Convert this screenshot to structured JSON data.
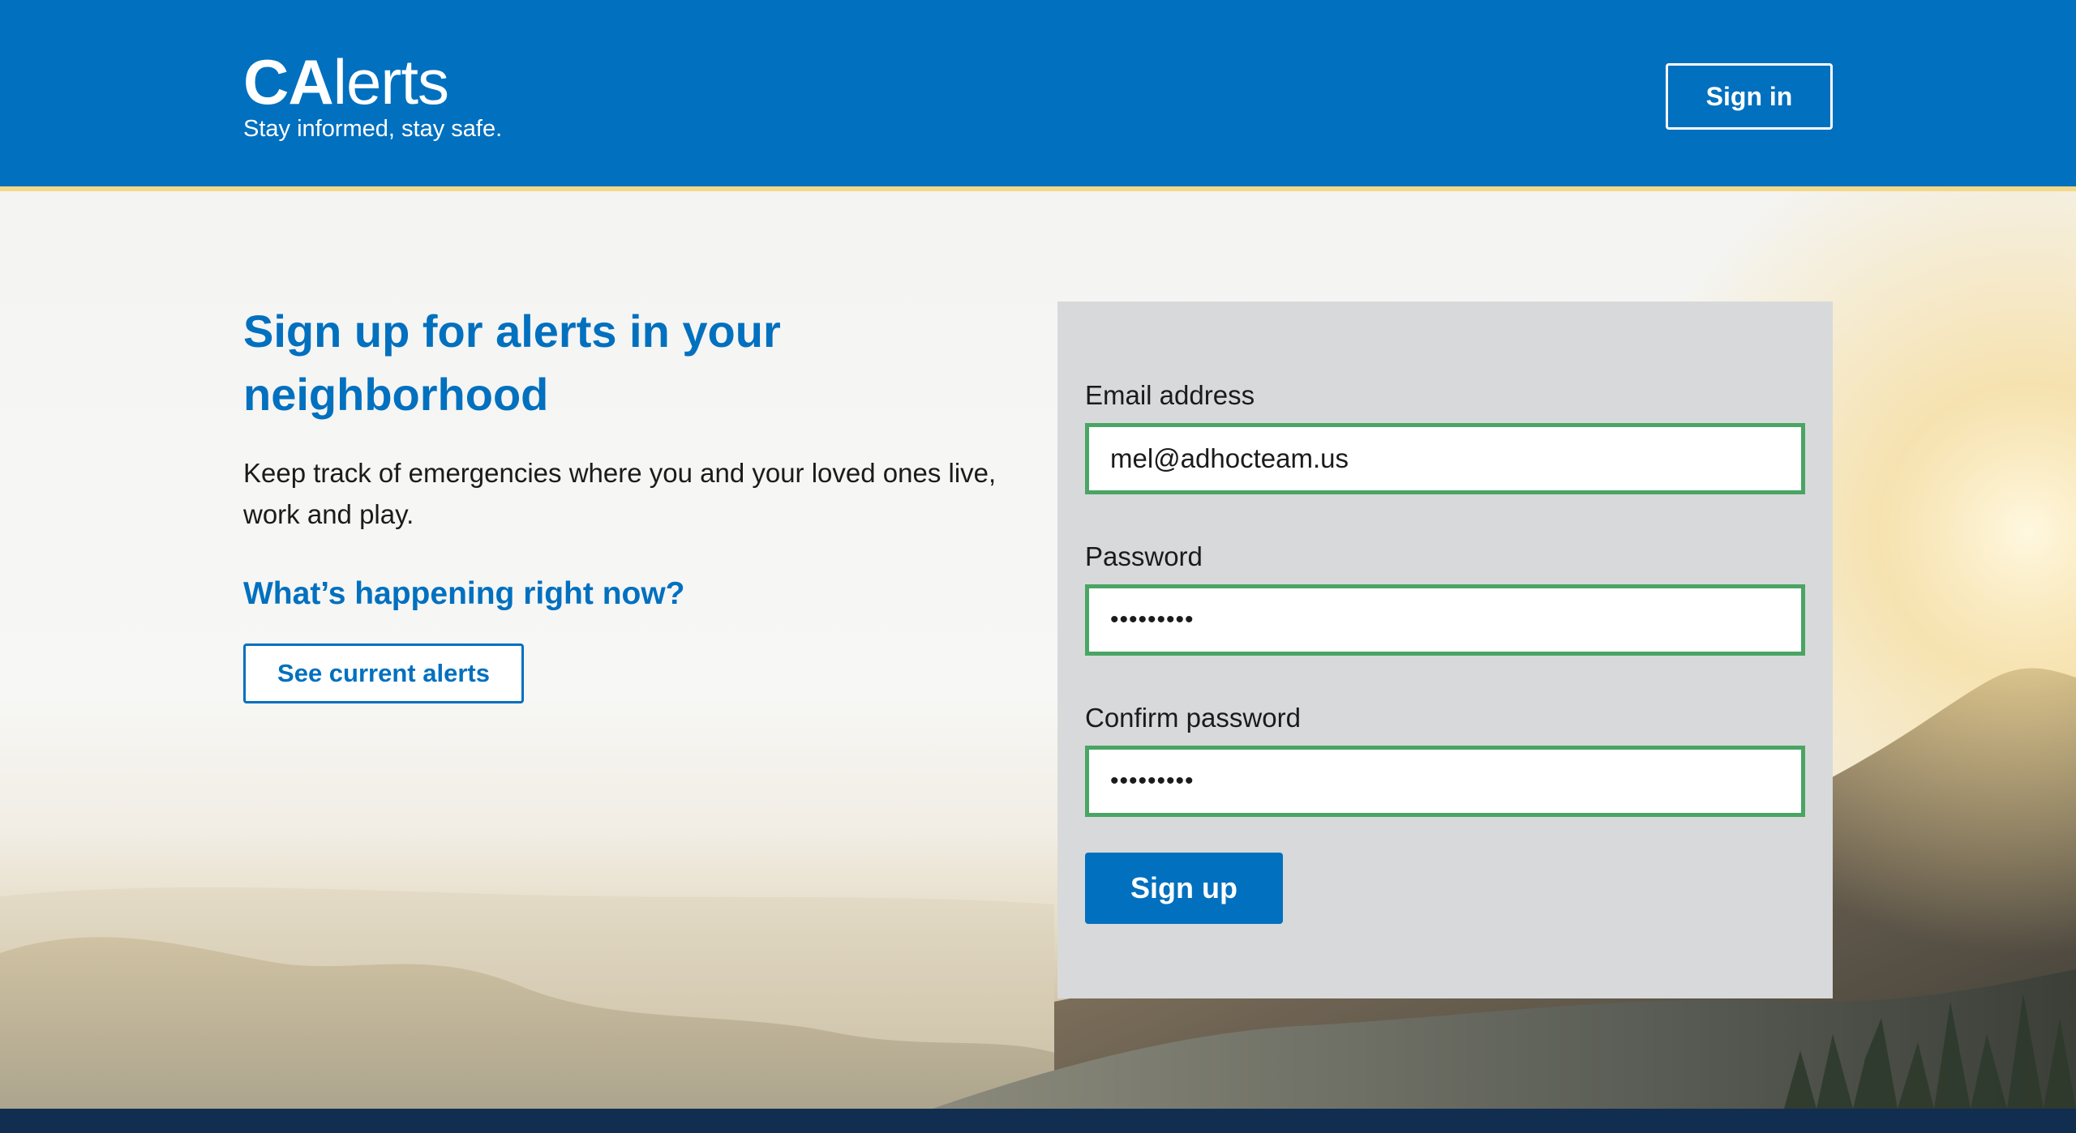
{
  "header": {
    "brand_bold": "CA",
    "brand_light": "lerts",
    "tagline": "Stay informed, stay safe.",
    "signin_label": "Sign in"
  },
  "intro": {
    "title": "Sign up for alerts in your neighborhood",
    "description": "Keep track of emergencies where you and your loved ones live, work and play.",
    "subheading": "What’s happening right now?",
    "alerts_button": "See current alerts"
  },
  "form": {
    "email_label": "Email address",
    "email_value": "mel@adhocteam.us",
    "password_label": "Password",
    "password_value": "•••••••••",
    "confirm_label": "Confirm password",
    "confirm_value": "•••••••••",
    "submit_label": "Sign up"
  },
  "colors": {
    "brand_blue": "#0070bf",
    "header_rule": "#f5d98a",
    "valid_border": "#4aa564",
    "panel_bg": "#d8d9da",
    "footer": "#112e51"
  }
}
